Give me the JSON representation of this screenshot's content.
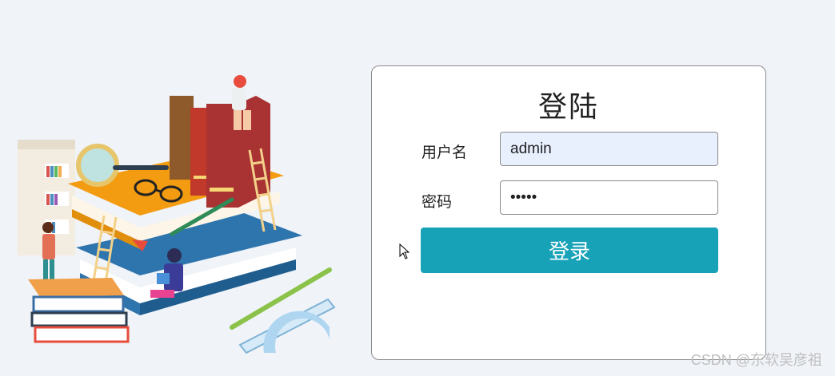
{
  "login": {
    "title": "登陆",
    "username_label": "用户名",
    "username_value": "admin",
    "password_label": "密码",
    "password_value": "admin",
    "submit_label": "登录"
  },
  "watermark": "CSDN @东软吴彦祖",
  "colors": {
    "accent": "#17a2b8",
    "background": "#f0f3f8",
    "autofill": "#e8f0fe"
  }
}
